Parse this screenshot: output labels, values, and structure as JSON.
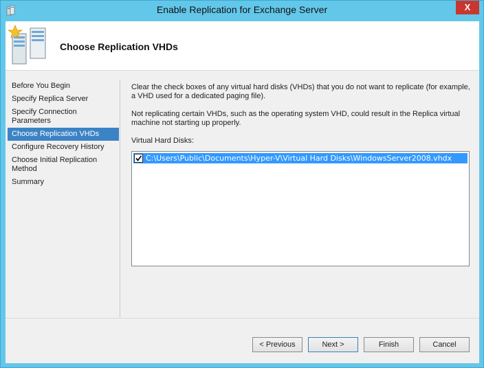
{
  "window": {
    "title": "Enable Replication for Exchange Server",
    "close_label": "X"
  },
  "header": {
    "title": "Choose Replication VHDs"
  },
  "nav": {
    "items": [
      {
        "label": "Before You Begin"
      },
      {
        "label": "Specify Replica Server"
      },
      {
        "label": "Specify Connection Parameters"
      },
      {
        "label": "Choose Replication VHDs",
        "active": true
      },
      {
        "label": "Configure Recovery History"
      },
      {
        "label": "Choose Initial Replication Method"
      },
      {
        "label": "Summary"
      }
    ]
  },
  "content": {
    "paragraph1": "Clear the check boxes of any virtual hard disks (VHDs) that you do not want to replicate (for example, a VHD used for a dedicated paging file).",
    "paragraph2": "Not replicating certain VHDs, such as the operating system VHD, could result in the Replica virtual machine not starting up properly.",
    "vhd_label": "Virtual Hard Disks:",
    "vhds": [
      {
        "path": "C:\\Users\\Public\\Documents\\Hyper-V\\Virtual Hard Disks\\WindowsServer2008.vhdx",
        "checked": true
      }
    ]
  },
  "buttons": {
    "previous": "< Previous",
    "next": "Next >",
    "finish": "Finish",
    "cancel": "Cancel"
  },
  "colors": {
    "title_bar": "#63c7ea",
    "selection": "#3399ff",
    "nav_active": "#3b83c5",
    "close": "#c7372f"
  },
  "icons": {
    "app": "server-wizard-icon",
    "header": "server-star-icon",
    "checkbox": "checkmark-icon"
  }
}
